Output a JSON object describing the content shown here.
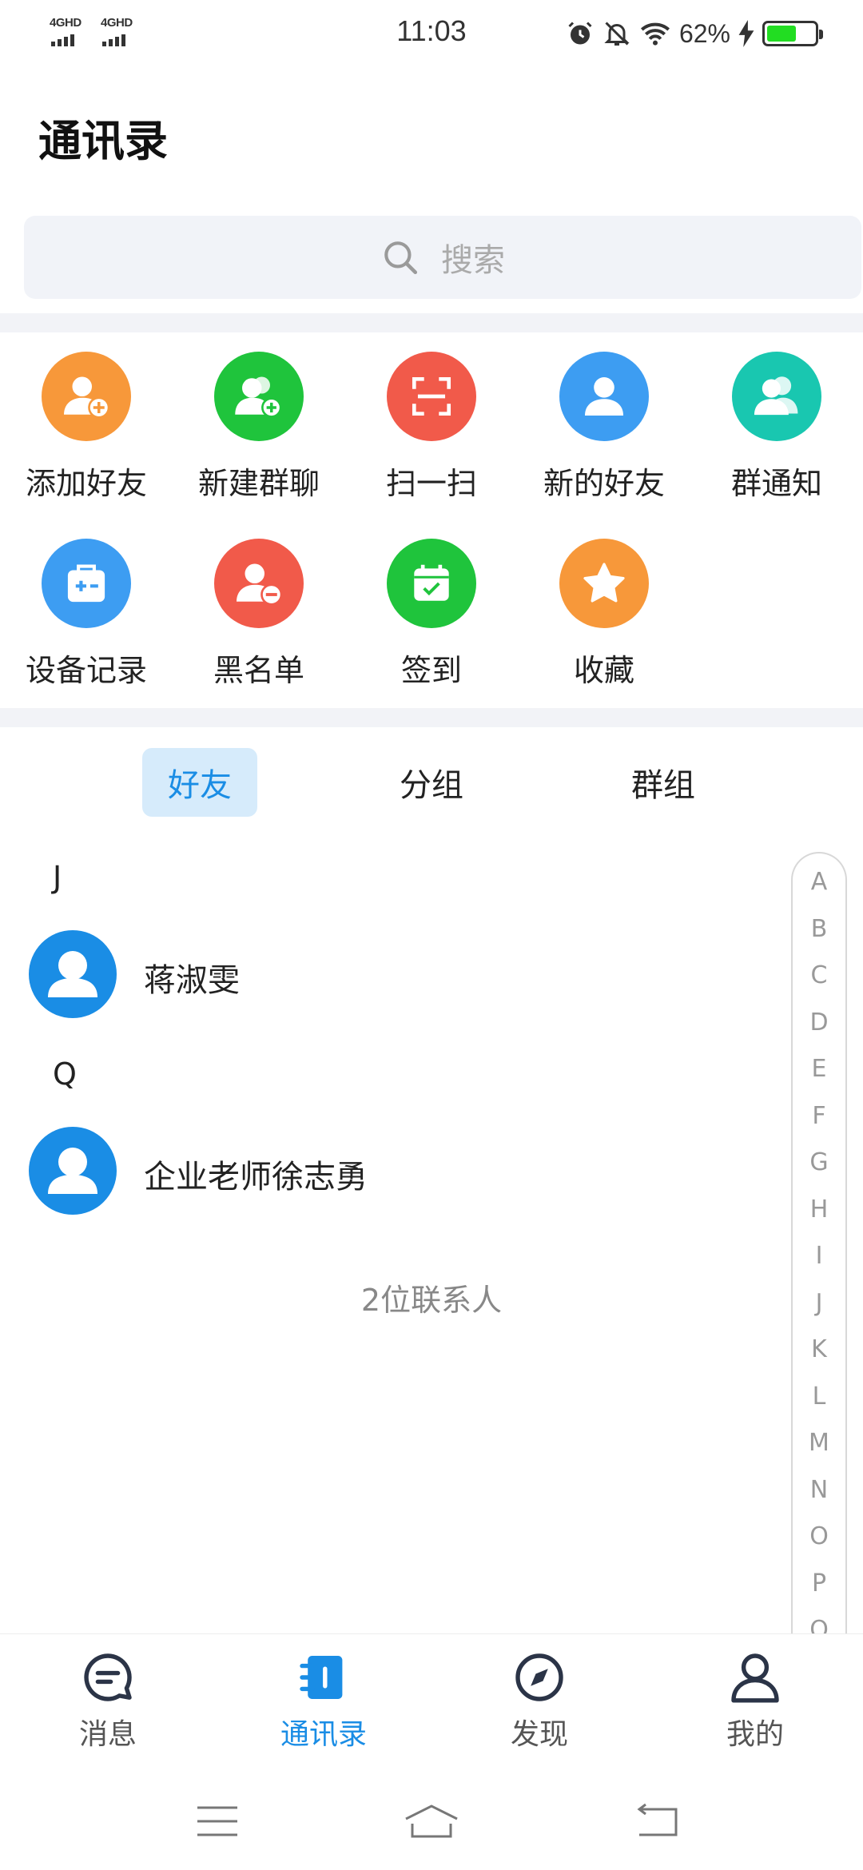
{
  "status_bar": {
    "signal_1": "4GHD",
    "signal_2": "4GHD",
    "time": "11:03",
    "battery_percent": "62%",
    "battery_level": 0.62
  },
  "header": {
    "title": "通讯录"
  },
  "search": {
    "placeholder": "搜索"
  },
  "shortcuts": [
    {
      "label": "添加好友",
      "icon": "add-friend-icon",
      "color": "#f7983a"
    },
    {
      "label": "新建群聊",
      "icon": "new-group-chat-icon",
      "color": "#1fc43c"
    },
    {
      "label": "扫一扫",
      "icon": "scan-icon",
      "color": "#f15a4a"
    },
    {
      "label": "新的好友",
      "icon": "new-friend-icon",
      "color": "#3d9df2"
    },
    {
      "label": "群通知",
      "icon": "group-notice-icon",
      "color": "#19c7b0"
    },
    {
      "label": "设备记录",
      "icon": "device-record-icon",
      "color": "#3d9df2"
    },
    {
      "label": "黑名单",
      "icon": "blacklist-icon",
      "color": "#f15a4a"
    },
    {
      "label": "签到",
      "icon": "check-in-icon",
      "color": "#1fc43c"
    },
    {
      "label": "收藏",
      "icon": "favorites-icon",
      "color": "#f7983a"
    }
  ],
  "tabs": [
    {
      "label": "好友",
      "active": true
    },
    {
      "label": "分组",
      "active": false
    },
    {
      "label": "群组",
      "active": false
    }
  ],
  "contacts": [
    {
      "letter": "J",
      "name": "蒋淑雯"
    },
    {
      "letter": "Q",
      "name": "企业老师徐志勇"
    }
  ],
  "contact_count": "2位联系人",
  "index_letters": [
    "A",
    "B",
    "C",
    "D",
    "E",
    "F",
    "G",
    "H",
    "I",
    "J",
    "K",
    "L",
    "M",
    "N",
    "O",
    "P",
    "Q"
  ],
  "bottom_nav": [
    {
      "label": "消息",
      "icon": "message-icon",
      "active": false
    },
    {
      "label": "通讯录",
      "icon": "contacts-icon",
      "active": true
    },
    {
      "label": "发现",
      "icon": "compass-icon",
      "active": false
    },
    {
      "label": "我的",
      "icon": "profile-icon",
      "active": false
    }
  ],
  "colors": {
    "accent": "#1a8de5",
    "tab_active_bg": "#d6ebfb"
  }
}
